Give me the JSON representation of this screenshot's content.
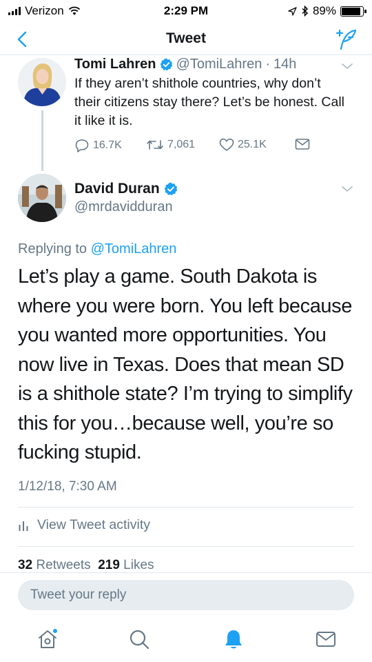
{
  "status_bar": {
    "carrier": "Verizon",
    "time": "2:29 PM",
    "battery": "89%",
    "battery_level": 0.89
  },
  "nav": {
    "title": "Tweet",
    "back_icon": "chevron-left-icon",
    "compose_icon": "compose-tweet-icon"
  },
  "parent_tweet": {
    "name": "Tomi Lahren",
    "handle": "@TomiLahren",
    "separator": "·",
    "age": "14h",
    "text": "If they aren’t shithole countries, why don’t their citizens stay there? Let’s be honest. Call it like it is.",
    "replies": "16.7K",
    "retweets": "7,061",
    "likes": "25.1K"
  },
  "main_tweet": {
    "name": "David Duran",
    "handle": "@mrdavidduran",
    "replying_prefix": "Replying to",
    "replying_to": "@TomiLahren",
    "text": "Let’s play a game. South Dakota is where you were born. You left because you wanted more opportunities. You now live in Texas. Does that mean SD is a shithole state? I’m trying to simplify this for you…because well, you’re so fucking stupid.",
    "timestamp": "1/12/18, 7:30 AM",
    "activity_label": "View Tweet activity",
    "retweet_count": "32",
    "retweet_label": "Retweets",
    "like_count": "219",
    "like_label": "Likes"
  },
  "reply": {
    "placeholder": "Tweet your reply"
  },
  "tabs": [
    {
      "name": "home",
      "icon": "home-icon"
    },
    {
      "name": "search",
      "icon": "search-icon"
    },
    {
      "name": "notifications",
      "icon": "bell-icon"
    },
    {
      "name": "messages",
      "icon": "mail-icon"
    }
  ],
  "colors": {
    "accent": "#1da1f2",
    "text": "#14171a",
    "secondary": "#657786",
    "divider": "#e1e8ed"
  }
}
